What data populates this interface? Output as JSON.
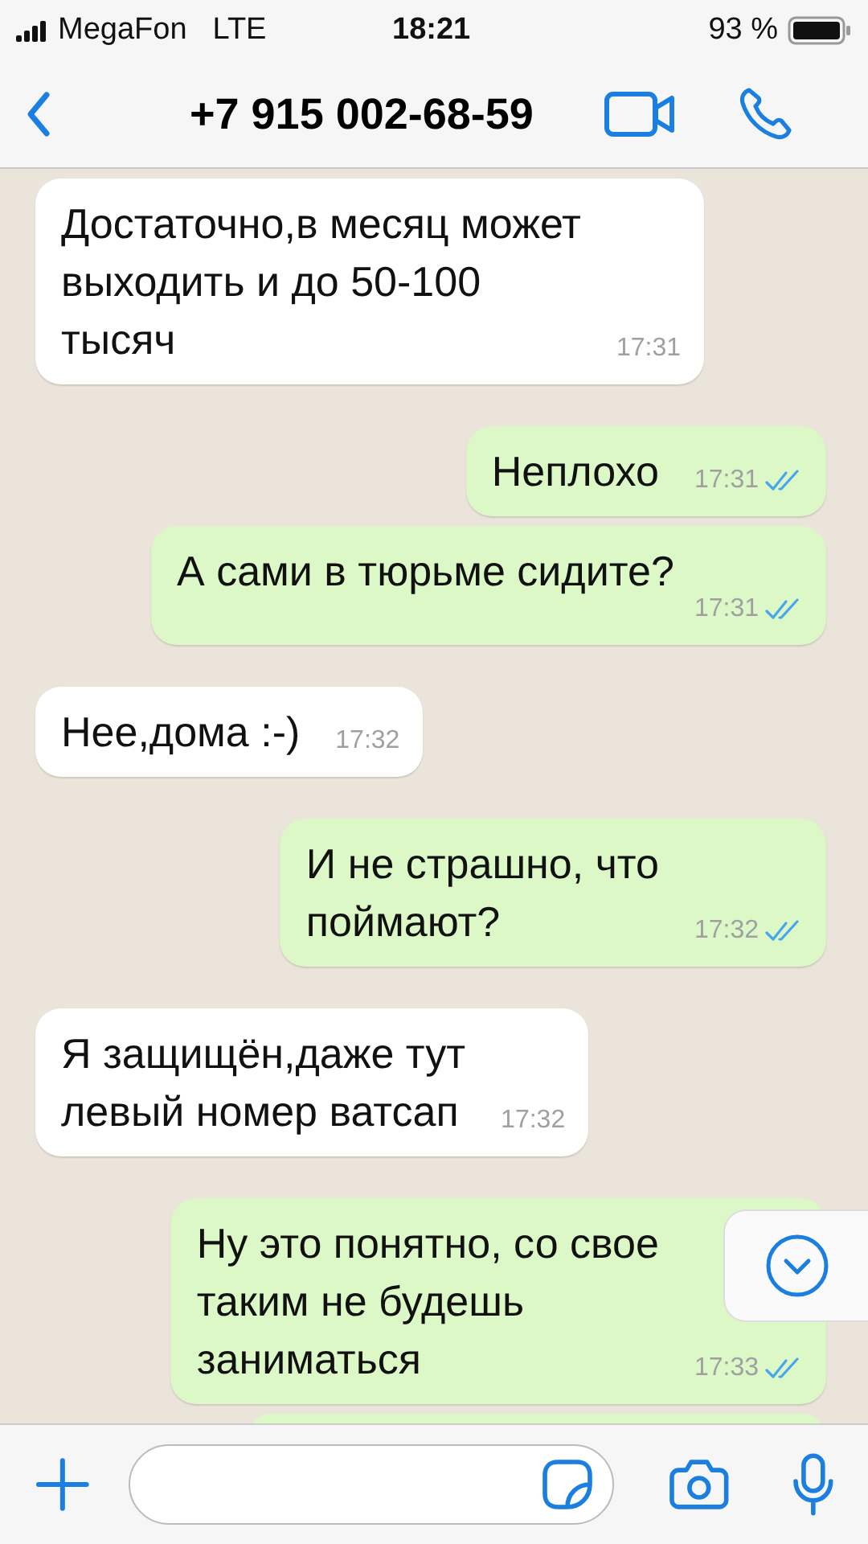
{
  "status_bar": {
    "carrier": "MegaFon",
    "network": "LTE",
    "time": "18:21",
    "battery": "93 %"
  },
  "header": {
    "title": "+7 915 002-68-59"
  },
  "messages": [
    {
      "kind": "in",
      "text": "Достаточно,в месяц может\nвыходить и до 50-100\nтысяч",
      "time": "17:31"
    },
    {
      "kind": "out",
      "text": "Неплохо",
      "time": "17:31",
      "read": true
    },
    {
      "kind": "out",
      "text": "А сами в тюрьме сидите?",
      "time": "17:31",
      "read": true
    },
    {
      "kind": "in",
      "text": "Нее,дома :-)",
      "time": "17:32"
    },
    {
      "kind": "out",
      "text": "И не страшно, что\nпоймают?",
      "time": "17:32",
      "read": true
    },
    {
      "kind": "in",
      "text": "Я защищён,даже тут\nлевый номер ватсап",
      "time": "17:32"
    },
    {
      "kind": "out",
      "text": "Ну это понятно, со свое\nтаким не будешь\nзаниматься",
      "time": "17:33",
      "read": true
    },
    {
      "kind": "out_partial"
    }
  ]
}
